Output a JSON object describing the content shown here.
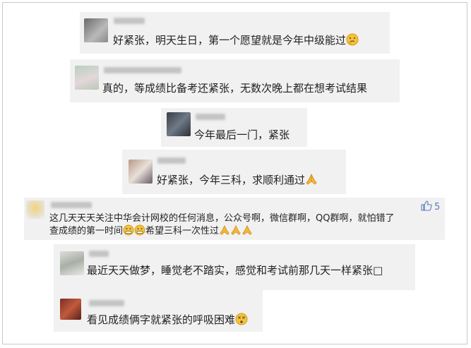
{
  "comments": [
    {
      "text": "好紧张，明天生日，第一个愿望就是今年中级能过",
      "emoji": "thinking-face"
    },
    {
      "text": "真的，等成绩比备考还紧张，无数次晚上都在想考试结果"
    },
    {
      "text": "今年最后一门，紧张"
    },
    {
      "text": "好紧张，今年三科，求顺利通过",
      "emoji": "folded-hands"
    },
    {
      "line1": "这几天天天关注中华会计网校的任何消息，公众号啊，微信群啊，QQ群啊，就怕错了",
      "line2": "查成绩的第一时间",
      "line2b": "希望三科一次性过",
      "likes": "5",
      "emojis": [
        "grimacing-face",
        "grimacing-face",
        "folded-hands",
        "folded-hands",
        "folded-hands"
      ]
    },
    {
      "text": "最近天天做梦，睡觉老不踏实，感觉和考试前那几天一样紧张□"
    },
    {
      "text": "看见成绩俩字就紧张的呼吸困难",
      "emoji": "dizzy-face"
    }
  ]
}
